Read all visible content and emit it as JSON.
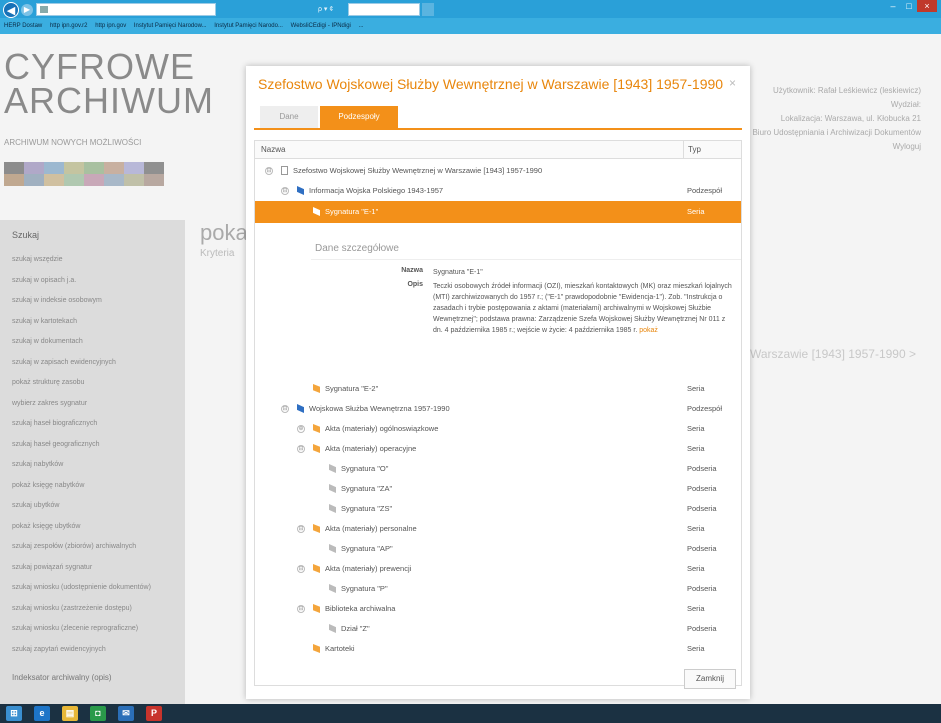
{
  "browser": {
    "address": "",
    "tab_title": "",
    "addr_controls": "ρ ▾ ¢",
    "favorites": [
      "HERP Dostaw",
      "http ipn.gov.r2",
      "http ipn.gov",
      "Instytut Pamięci Narodow...",
      "Instytut Pamięci Narodo...",
      "WebsliCEdigi - IPNdigi",
      "..."
    ],
    "window_controls": [
      "–",
      "□",
      "×"
    ]
  },
  "background": {
    "logo_line1": "CYFROWE",
    "logo_line2": "ARCHIWUM",
    "logo_sub": "ARCHIWUM NOWYCH MOŻLIWOŚCI",
    "user_lines": [
      "Użytkownik: Rafał Leśkiewicz (leskiewicz)",
      "Wydział:",
      "Lokalizacja: Warszawa, ul. Kłobucka 21",
      "Biuro Udostępniania i Archiwizacji Dokumentów",
      "Wyloguj"
    ],
    "sidebar_title": "Szukaj",
    "sidebar_items": [
      "szukaj wszędzie",
      "szukaj w opisach j.a.",
      "szukaj w indeksie osobowym",
      "szukaj w kartotekach",
      "szukaj w dokumentach",
      "szukaj w zapisach ewidencyjnych",
      "pokaż strukturę zasobu",
      "wybierz zakres sygnatur",
      "szukaj haseł biograficznych",
      "szukaj haseł geograficznych",
      "szukaj nabytków",
      "pokaż księgę nabytków",
      "szukaj ubytków",
      "pokaż księgę ubytków",
      "szukaj zespołów (zbiorów) archiwalnych",
      "szukaj powiązań sygnatur",
      "szukaj wniosku (udostępnienie dokumentów)",
      "szukaj wniosku (zastrzeżenie dostępu)",
      "szukaj wniosku (zlecenie reprograficzne)",
      "szukaj zapytań ewidencyjnych"
    ],
    "sidebar_title2": "Indeksator archiwalny (opis)",
    "poka": "poka",
    "kryt": "Kryteria",
    "right_title": "Warszawie [1943] 1957-1990  >"
  },
  "modal": {
    "title": "Szefostwo Wojskowej Służby Wewnętrznej w Warszawie [1943] 1957-1990",
    "close": "×",
    "tab_dane": "Dane",
    "tab_podzespoly": "Podzespoły",
    "col_nazwa": "Nazwa",
    "col_typ": "Typ",
    "rows": [
      {
        "label": "Szefostwo Wojskowej Służby Wewnętrznej w Warszawie [1943] 1957-1990",
        "typ": "",
        "expander": "⊟"
      },
      {
        "label": "Informacja Wojska Polskiego 1943-1957",
        "typ": "Podzespół",
        "expander": "⊟"
      },
      {
        "label": "Sygnatura \"E-1\"",
        "typ": "Seria",
        "expander": ""
      },
      {
        "label": "Sygnatura \"E-2\"",
        "typ": "Seria",
        "expander": ""
      },
      {
        "label": "Wojskowa Służba Wewnętrzna 1957-1990",
        "typ": "Podzespół",
        "expander": "⊟"
      },
      {
        "label": "Akta (materiały) ogólnoswiązkowe",
        "typ": "Seria",
        "expander": "⊕"
      },
      {
        "label": "Akta (materiały) operacyjne",
        "typ": "Seria",
        "expander": "⊟"
      },
      {
        "label": "Sygnatura \"O\"",
        "typ": "Podseria",
        "expander": ""
      },
      {
        "label": "Sygnatura \"ZA\"",
        "typ": "Podseria",
        "expander": ""
      },
      {
        "label": "Sygnatura \"ZS\"",
        "typ": "Podseria",
        "expander": ""
      },
      {
        "label": "Akta (materiały) personalne",
        "typ": "Seria",
        "expander": "⊟"
      },
      {
        "label": "Sygnatura \"AP\"",
        "typ": "Podseria",
        "expander": ""
      },
      {
        "label": "Akta (materiały) prewencji",
        "typ": "Seria",
        "expander": "⊟"
      },
      {
        "label": "Sygnatura \"P\"",
        "typ": "Podseria",
        "expander": ""
      },
      {
        "label": "Biblioteka archiwalna",
        "typ": "Seria",
        "expander": "⊟"
      },
      {
        "label": "Dział \"Z\"",
        "typ": "Podseria",
        "expander": ""
      },
      {
        "label": "Kartoteki",
        "typ": "Seria",
        "expander": ""
      }
    ],
    "details": {
      "title": "Dane szczegółowe",
      "nazwa_key": "Nazwa",
      "nazwa_val": "Sygnatura \"E-1\"",
      "opis_key": "Opis",
      "opis_val": "Teczki osobowych źródeł informacji (OZI), mieszkań kontaktowych (MK) oraz mieszkań lojalnych (MTI) zarchiwizowanych do 1957 r.; (\"E-1\" prawdopodobnie \"Ewidencja-1\"). Zob. \"Instrukcja o zasadach i trybie postępowania z aktami (materiałami) archiwalnymi w Wojskowej Służbie Wewnętrznej\"; podstawa prawna: Zarządzenie Szefa Wojskowej Służby Wewnętrznej Nr 011 z dn. 4 października 1985 r.; wejście w życie: 4 października 1985 r.",
      "opis_link": "pokaż"
    },
    "close_button": "Zamknij"
  },
  "taskbar": {
    "clock_time": "",
    "clock_date": ""
  }
}
